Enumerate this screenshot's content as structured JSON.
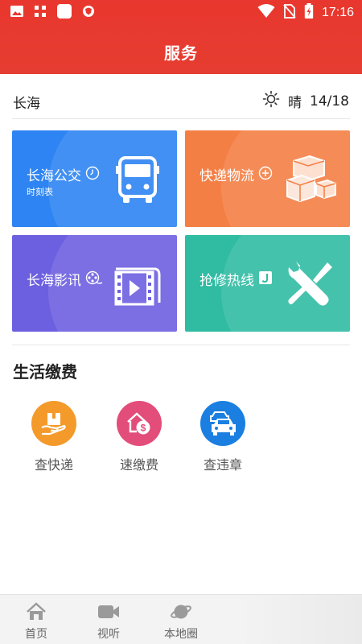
{
  "status_bar": {
    "time": "17:16",
    "left_icons": [
      "image-icon",
      "grid-icon",
      "app-square-icon",
      "shield-icon"
    ],
    "right_icons": [
      "wifi-icon",
      "no-sim-icon",
      "battery-charging-icon"
    ]
  },
  "header": {
    "title": "服务"
  },
  "weather": {
    "city": "长海",
    "icon": "sun-icon",
    "condition": "晴",
    "temperature": "14/18"
  },
  "tiles": [
    {
      "label": "长海公交",
      "sub": "时刻表",
      "color": "#2d84f2",
      "badge_icon": "clock-icon",
      "art_icon": "bus-icon"
    },
    {
      "label": "快递物流",
      "sub": "",
      "color": "#f47f45",
      "badge_icon": "plus-circle-icon",
      "art_icon": "boxes-icon"
    },
    {
      "label": "长海影讯",
      "sub": "",
      "color": "#6c5fe0",
      "badge_icon": "film-reel-icon",
      "art_icon": "film-play-icon"
    },
    {
      "label": "抢修热线",
      "sub": "",
      "color": "#30bba3",
      "badge_icon": "phone-icon",
      "art_icon": "tools-icon"
    }
  ],
  "section": {
    "title": "生活缴费"
  },
  "services": [
    {
      "label": "查快递",
      "color": "#f49a2a",
      "icon": "package-hand-icon"
    },
    {
      "label": "速缴费",
      "color": "#e34d7a",
      "icon": "home-coin-icon"
    },
    {
      "label": "查违章",
      "color": "#1a7fe0",
      "icon": "cars-icon"
    }
  ],
  "tabbar": {
    "items": [
      {
        "label": "首页",
        "icon": "home-icon"
      },
      {
        "label": "视听",
        "icon": "video-icon"
      },
      {
        "label": "本地圈",
        "icon": "planet-icon"
      }
    ]
  }
}
